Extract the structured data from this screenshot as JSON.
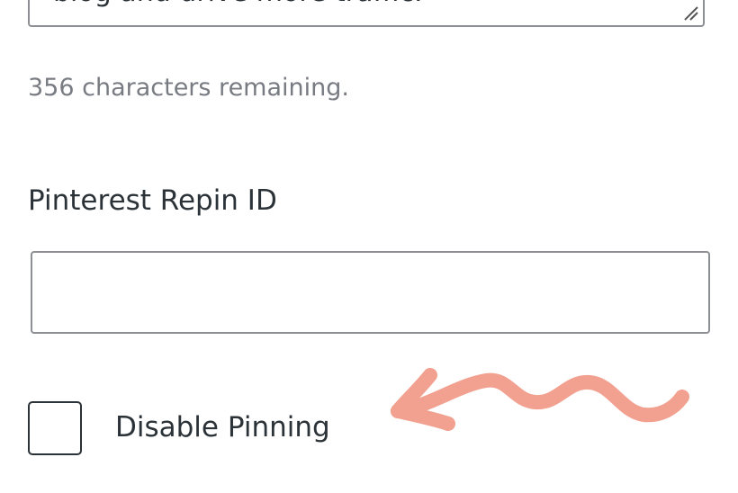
{
  "excerpt_field": {
    "value": "blog and drive more traffic."
  },
  "char_counter": {
    "text": "356 characters remaining."
  },
  "repin_field": {
    "label": "Pinterest Repin ID",
    "value": "",
    "placeholder": ""
  },
  "disable_pinning": {
    "label": "Disable Pinning",
    "checked": false
  },
  "annotation": {
    "icon": "hand-drawn-arrow-icon",
    "color": "#f2a08f"
  }
}
